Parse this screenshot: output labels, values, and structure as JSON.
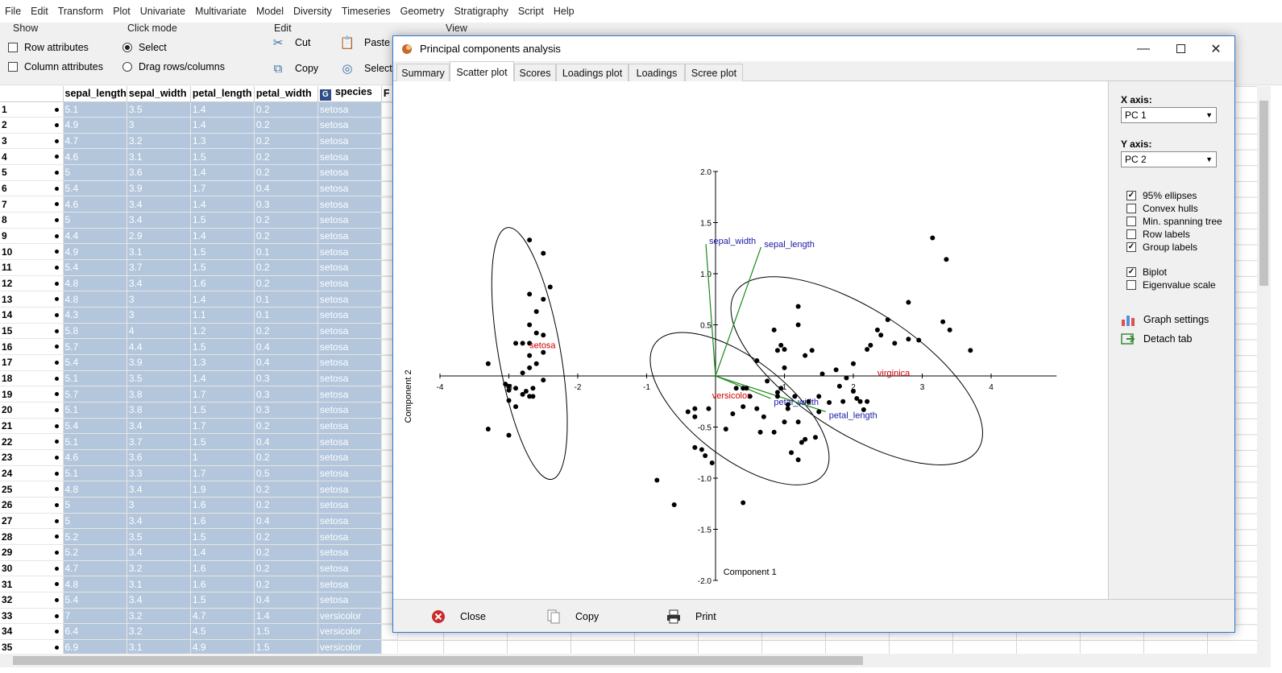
{
  "menu": [
    "File",
    "Edit",
    "Transform",
    "Plot",
    "Univariate",
    "Multivariate",
    "Model",
    "Diversity",
    "Timeseries",
    "Geometry",
    "Stratigraphy",
    "Script",
    "Help"
  ],
  "ribbon": {
    "show": {
      "title": "Show",
      "row_attributes": "Row attributes",
      "column_attributes": "Column attributes"
    },
    "click_mode": {
      "title": "Click mode",
      "select": "Select",
      "drag": "Drag rows/columns"
    },
    "edit": {
      "title": "Edit",
      "cut": "Cut",
      "copy": "Copy",
      "paste": "Paste",
      "select": "Select"
    },
    "view": {
      "title": "View"
    }
  },
  "table": {
    "headers": [
      "sepal_length",
      "sepal_width",
      "petal_length",
      "petal_width",
      "species",
      "F"
    ],
    "group_badge": "G",
    "rows": [
      [
        "1",
        "5.1",
        "3.5",
        "1.4",
        "0.2",
        "setosa"
      ],
      [
        "2",
        "4.9",
        "3",
        "1.4",
        "0.2",
        "setosa"
      ],
      [
        "3",
        "4.7",
        "3.2",
        "1.3",
        "0.2",
        "setosa"
      ],
      [
        "4",
        "4.6",
        "3.1",
        "1.5",
        "0.2",
        "setosa"
      ],
      [
        "5",
        "5",
        "3.6",
        "1.4",
        "0.2",
        "setosa"
      ],
      [
        "6",
        "5.4",
        "3.9",
        "1.7",
        "0.4",
        "setosa"
      ],
      [
        "7",
        "4.6",
        "3.4",
        "1.4",
        "0.3",
        "setosa"
      ],
      [
        "8",
        "5",
        "3.4",
        "1.5",
        "0.2",
        "setosa"
      ],
      [
        "9",
        "4.4",
        "2.9",
        "1.4",
        "0.2",
        "setosa"
      ],
      [
        "10",
        "4.9",
        "3.1",
        "1.5",
        "0.1",
        "setosa"
      ],
      [
        "11",
        "5.4",
        "3.7",
        "1.5",
        "0.2",
        "setosa"
      ],
      [
        "12",
        "4.8",
        "3.4",
        "1.6",
        "0.2",
        "setosa"
      ],
      [
        "13",
        "4.8",
        "3",
        "1.4",
        "0.1",
        "setosa"
      ],
      [
        "14",
        "4.3",
        "3",
        "1.1",
        "0.1",
        "setosa"
      ],
      [
        "15",
        "5.8",
        "4",
        "1.2",
        "0.2",
        "setosa"
      ],
      [
        "16",
        "5.7",
        "4.4",
        "1.5",
        "0.4",
        "setosa"
      ],
      [
        "17",
        "5.4",
        "3.9",
        "1.3",
        "0.4",
        "setosa"
      ],
      [
        "18",
        "5.1",
        "3.5",
        "1.4",
        "0.3",
        "setosa"
      ],
      [
        "19",
        "5.7",
        "3.8",
        "1.7",
        "0.3",
        "setosa"
      ],
      [
        "20",
        "5.1",
        "3.8",
        "1.5",
        "0.3",
        "setosa"
      ],
      [
        "21",
        "5.4",
        "3.4",
        "1.7",
        "0.2",
        "setosa"
      ],
      [
        "22",
        "5.1",
        "3.7",
        "1.5",
        "0.4",
        "setosa"
      ],
      [
        "23",
        "4.6",
        "3.6",
        "1",
        "0.2",
        "setosa"
      ],
      [
        "24",
        "5.1",
        "3.3",
        "1.7",
        "0.5",
        "setosa"
      ],
      [
        "25",
        "4.8",
        "3.4",
        "1.9",
        "0.2",
        "setosa"
      ],
      [
        "26",
        "5",
        "3",
        "1.6",
        "0.2",
        "setosa"
      ],
      [
        "27",
        "5",
        "3.4",
        "1.6",
        "0.4",
        "setosa"
      ],
      [
        "28",
        "5.2",
        "3.5",
        "1.5",
        "0.2",
        "setosa"
      ],
      [
        "29",
        "5.2",
        "3.4",
        "1.4",
        "0.2",
        "setosa"
      ],
      [
        "30",
        "4.7",
        "3.2",
        "1.6",
        "0.2",
        "setosa"
      ],
      [
        "31",
        "4.8",
        "3.1",
        "1.6",
        "0.2",
        "setosa"
      ],
      [
        "32",
        "5.4",
        "3.4",
        "1.5",
        "0.4",
        "setosa"
      ],
      [
        "33",
        "7",
        "3.2",
        "4.7",
        "1.4",
        "versicolor"
      ],
      [
        "34",
        "6.4",
        "3.2",
        "4.5",
        "1.5",
        "versicolor"
      ],
      [
        "35",
        "6.9",
        "3.1",
        "4.9",
        "1.5",
        "versicolor"
      ]
    ]
  },
  "window": {
    "title": "Principal components analysis",
    "tabs": [
      "Summary",
      "Scatter plot",
      "Scores",
      "Loadings plot",
      "Loadings",
      "Scree plot"
    ],
    "active_tab": "Scatter plot",
    "footer": {
      "close": "Close",
      "copy": "Copy",
      "print": "Print"
    }
  },
  "side_panel": {
    "x_axis_label": "X axis:",
    "x_axis_value": "PC 1",
    "y_axis_label": "Y axis:",
    "y_axis_value": "PC 2",
    "options": [
      {
        "label": "95% ellipses",
        "checked": true
      },
      {
        "label": "Convex hulls",
        "checked": false
      },
      {
        "label": "Min. spanning tree",
        "checked": false
      },
      {
        "label": "Row labels",
        "checked": false
      },
      {
        "label": "Group labels",
        "checked": true
      }
    ],
    "options2": [
      {
        "label": "Biplot",
        "checked": true
      },
      {
        "label": "Eigenvalue scale",
        "checked": false
      }
    ],
    "graph_settings": "Graph settings",
    "detach_tab": "Detach tab"
  },
  "chart_data": {
    "type": "scatter",
    "xlabel": "Component 1",
    "ylabel": "Component 2",
    "xlim": [
      -4,
      5
    ],
    "ylim": [
      -2,
      2
    ],
    "xticks": [
      -4,
      -3,
      -2,
      -1,
      1,
      2,
      3,
      4
    ],
    "yticks": [
      -2.0,
      -1.5,
      -1.0,
      -0.5,
      0.5,
      1.0,
      1.5,
      2.0
    ],
    "xtick_labels": [
      "-4",
      "-3",
      "-2",
      "-1",
      "1",
      "2",
      "3",
      "4"
    ],
    "ytick_labels": [
      "-2.0",
      "-1.5",
      "-1.0",
      "-0.5",
      "0.5",
      "1.0",
      "1.5",
      "2.0"
    ],
    "point_color": "#000000",
    "ellipse_color": "#000000",
    "group_label_color": "#cc0000",
    "loading_color": "#1a8a1a",
    "loading_label_color": "#1a1aa6",
    "groups": [
      {
        "name": "setosa",
        "label_at": [
          -2.7,
          0.27
        ],
        "ellipse": {
          "cx": -2.7,
          "cy": 0.22,
          "rx": 0.45,
          "ry": 1.25,
          "angle_deg": -10
        },
        "points": [
          [
            -2.7,
            1.33
          ],
          [
            -2.5,
            1.2
          ],
          [
            -2.4,
            0.87
          ],
          [
            -2.5,
            0.75
          ],
          [
            -2.7,
            0.8
          ],
          [
            -2.6,
            0.63
          ],
          [
            -2.7,
            0.5
          ],
          [
            -2.6,
            0.42
          ],
          [
            -2.5,
            0.4
          ],
          [
            -2.8,
            0.32
          ],
          [
            -2.7,
            0.32
          ],
          [
            -2.9,
            0.32
          ],
          [
            -2.5,
            0.23
          ],
          [
            -2.6,
            0.12
          ],
          [
            -2.7,
            0.2
          ],
          [
            -3.3,
            0.12
          ],
          [
            -2.7,
            0.08
          ],
          [
            -2.5,
            -0.04
          ],
          [
            -2.8,
            0.03
          ],
          [
            -2.9,
            -0.12
          ],
          [
            -3.0,
            -0.1
          ],
          [
            -3.0,
            -0.14
          ],
          [
            -2.75,
            -0.15
          ],
          [
            -2.7,
            -0.2
          ],
          [
            -2.8,
            -0.18
          ],
          [
            -2.9,
            -0.3
          ],
          [
            -3.0,
            -0.24
          ],
          [
            -2.65,
            -0.12
          ],
          [
            -3.3,
            -0.52
          ],
          [
            -3.0,
            -0.58
          ],
          [
            -2.65,
            -0.2
          ],
          [
            -3.05,
            -0.08
          ]
        ]
      },
      {
        "name": "versicolor",
        "label_at": [
          -0.05,
          -0.22
        ],
        "ellipse": {
          "cx": 0.35,
          "cy": -0.32,
          "rx": 1.55,
          "ry": 0.48,
          "angle_deg": 38
        },
        "points": [
          [
            -0.85,
            -1.02
          ],
          [
            -0.6,
            -1.26
          ],
          [
            -0.4,
            -0.35
          ],
          [
            -0.3,
            -0.7
          ],
          [
            -0.2,
            -0.72
          ],
          [
            -0.15,
            -0.78
          ],
          [
            -0.3,
            -0.32
          ],
          [
            -0.1,
            -0.32
          ],
          [
            -0.05,
            -0.85
          ],
          [
            0.15,
            -0.52
          ],
          [
            0.25,
            -0.37
          ],
          [
            0.3,
            -0.12
          ],
          [
            0.4,
            -0.3
          ],
          [
            0.45,
            -0.12
          ],
          [
            0.5,
            -0.2
          ],
          [
            0.6,
            -0.32
          ],
          [
            0.7,
            -0.4
          ],
          [
            0.65,
            -0.55
          ],
          [
            0.75,
            -0.05
          ],
          [
            0.6,
            0.15
          ],
          [
            0.9,
            0.25
          ],
          [
            0.85,
            0.45
          ],
          [
            1.0,
            0.26
          ],
          [
            0.95,
            0.3
          ],
          [
            1.2,
            0.5
          ],
          [
            1.2,
            0.68
          ],
          [
            1.3,
            0.2
          ],
          [
            1.4,
            0.25
          ],
          [
            0.4,
            -0.12
          ],
          [
            0.9,
            -0.16
          ],
          [
            0.95,
            -0.12
          ],
          [
            1.0,
            0.08
          ],
          [
            0.9,
            -0.2
          ],
          [
            -0.3,
            -0.4
          ],
          [
            0.4,
            -1.24
          ]
        ]
      },
      {
        "name": "virginica",
        "label_at": [
          2.35,
          0.0
        ],
        "ellipse": {
          "cx": 2.05,
          "cy": 0.05,
          "rx": 2.1,
          "ry": 0.6,
          "angle_deg": 33
        },
        "points": [
          [
            3.15,
            1.35
          ],
          [
            3.35,
            1.14
          ],
          [
            2.8,
            0.72
          ],
          [
            3.3,
            0.53
          ],
          [
            3.4,
            0.45
          ],
          [
            3.7,
            0.25
          ],
          [
            2.8,
            0.36
          ],
          [
            2.95,
            0.35
          ],
          [
            2.5,
            0.55
          ],
          [
            2.6,
            0.32
          ],
          [
            2.35,
            0.45
          ],
          [
            2.25,
            0.3
          ],
          [
            2.0,
            0.12
          ],
          [
            1.75,
            0.06
          ],
          [
            2.4,
            0.4
          ],
          [
            2.2,
            0.26
          ],
          [
            1.9,
            -0.02
          ],
          [
            2.05,
            -0.22
          ],
          [
            2.2,
            -0.25
          ],
          [
            1.85,
            -0.25
          ],
          [
            1.65,
            -0.26
          ],
          [
            1.5,
            -0.35
          ],
          [
            1.25,
            -0.65
          ],
          [
            1.45,
            -0.6
          ],
          [
            1.2,
            -0.45
          ],
          [
            1.1,
            -0.75
          ],
          [
            1.2,
            -0.82
          ],
          [
            1.0,
            -0.45
          ],
          [
            1.05,
            -0.32
          ],
          [
            1.15,
            -0.2
          ],
          [
            1.35,
            -0.25
          ],
          [
            2.15,
            -0.33
          ],
          [
            1.8,
            -0.1
          ],
          [
            2.0,
            -0.15
          ],
          [
            1.05,
            -0.28
          ],
          [
            0.85,
            -0.55
          ],
          [
            1.3,
            -0.62
          ],
          [
            1.5,
            -0.2
          ],
          [
            2.1,
            -0.25
          ],
          [
            1.55,
            0.02
          ]
        ]
      }
    ],
    "loadings": [
      {
        "name": "sepal_length",
        "x": 0.66,
        "y": 1.26
      },
      {
        "name": "sepal_width",
        "x": -0.14,
        "y": 1.29
      },
      {
        "name": "petal_length",
        "x": 1.6,
        "y": -0.35
      },
      {
        "name": "petal_width",
        "x": 0.8,
        "y": -0.22
      }
    ]
  }
}
